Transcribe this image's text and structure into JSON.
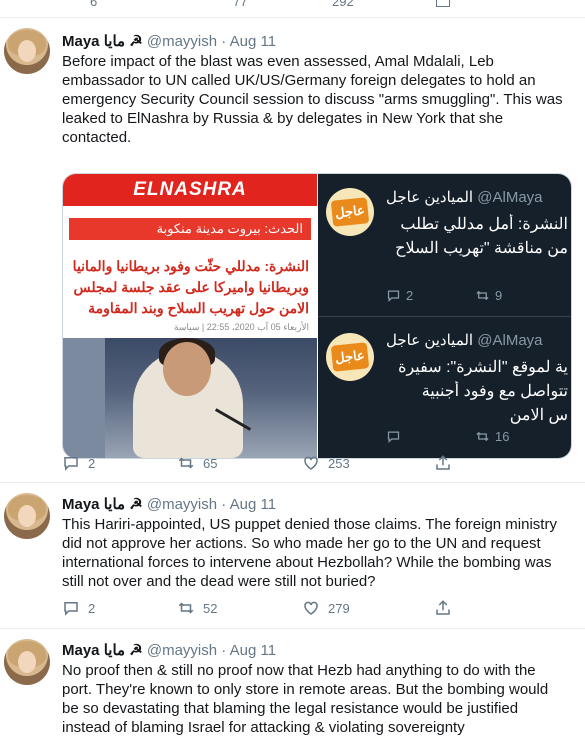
{
  "top_actions": {
    "reply": "6",
    "retweet": "77",
    "like": "292"
  },
  "tweets": [
    {
      "display_name": "Maya مايا",
      "flag_glyph": "☭",
      "handle": "@mayyish",
      "date": "Aug 11",
      "text": "Before impact of the blast was even assessed, Amal Mdalali, Leb embassador to UN called UK/US/Germany foreign delegates to hold an emergency Security Council session to discuss \"arms smuggling\". This was leaked to ElNashra by Russia & by delegates in New York that she contacted.",
      "replies": "2",
      "retweets": "65",
      "likes": "253"
    },
    {
      "display_name": "Maya مايا",
      "flag_glyph": "☭",
      "handle": "@mayyish",
      "date": "Aug 11",
      "text": "This Hariri-appointed, US puppet denied those claims. The foreign ministry did not approve her actions. So who made her go to the UN and request international forces to intervene about Hezbollah? While the bombing was still not over and the dead were still not buried?",
      "replies": "2",
      "retweets": "52",
      "likes": "279"
    },
    {
      "display_name": "Maya مايا",
      "flag_glyph": "☭",
      "handle": "@mayyish",
      "date": "Aug 11",
      "text": "No proof then & still no proof now that Hezb had anything to do with the port. They're known to only store in remote areas. But the bombing would be so devastating that blaming the legal resistance would be justified instead of blaming Israel for attacking & violating sovereignty"
    }
  ],
  "media": {
    "logo": "ELNASHRA",
    "breaking": "الحدث: بيروت مدينة منكوبة",
    "headline": "النشرة: مدللي حثّت وفود بريطانيا والمانيا وبريطانيا واميركا على عقد جلسة لمجلس الامن حول تهريب السلاح وبند المقاومة",
    "date": "الأربعاء 05 آب 2020، 22:55 | سياسة",
    "cards": [
      {
        "badge": "عاجل",
        "name": "الميادين عاجل",
        "handle": "@AlMaya",
        "line1": "النشرة: أمل مدللي تطلب",
        "line2": "من مناقشة \"تهريب السلاح",
        "replies": "2",
        "retweets": "9"
      },
      {
        "badge": "عاجل",
        "name": "الميادين عاجل",
        "handle": "@AlMaya",
        "line1": "ية لموقع \"النشرة\": سفيرة",
        "line2": "تتواصل مع وفود أجنبية",
        "line3": "س الامن",
        "retweets": "16"
      }
    ]
  },
  "colors": {
    "secondary": "#657786",
    "border": "#e6ecf0",
    "red": "#e2241e",
    "dark": "#15202b"
  }
}
